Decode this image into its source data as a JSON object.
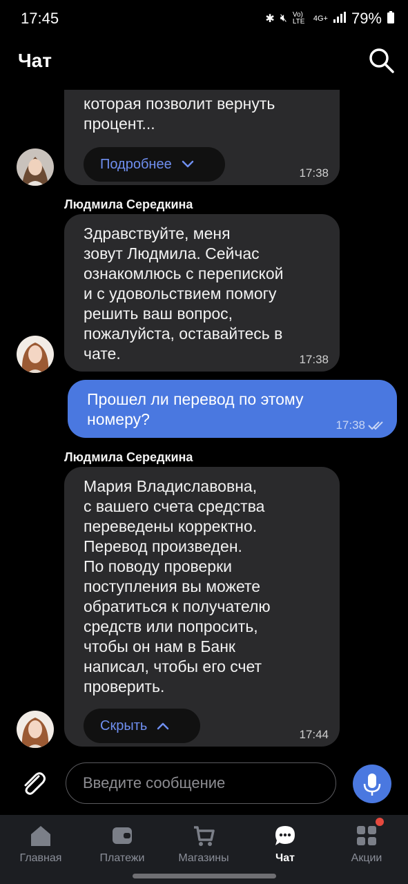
{
  "status": {
    "time": "17:45",
    "network_vo": "Vo) LTE",
    "network_4g": "4G+",
    "battery": "79%"
  },
  "header": {
    "title": "Чат"
  },
  "messages": [
    {
      "type": "incoming",
      "text": "которая позволит вернуть\nпроцент...",
      "button_label": "Подробнее",
      "time": "17:38"
    },
    {
      "type": "incoming",
      "sender": "Людмила Середкина",
      "text": "Здравствуйте, меня\nзовут Людмила. Сейчас\nознакомлюсь с перепиской\nи с удовольствием помогу\nрешить ваш вопрос,\nпожалуйста, оставайтесь в\nчате.",
      "time": "17:38"
    },
    {
      "type": "outgoing",
      "text": "Прошел ли перевод по этому\nномеру?",
      "time": "17:38",
      "status": "read"
    },
    {
      "type": "incoming",
      "sender": "Людмила Середкина",
      "text": "Мария Владиславовна,\nс вашего счета средства\nпереведены корректно.\nПеревод произведен.\nПо поводу проверки\nпоступления вы можете\nобратиться к получателю\nсредств или попросить,\nчтобы он нам в Банк\nнаписал, чтобы его счет\nпроверить.",
      "button_label": "Скрыть",
      "time": "17:44"
    }
  ],
  "composer": {
    "placeholder": "Введите сообщение"
  },
  "tabs": [
    {
      "label": "Главная",
      "icon": "home-icon"
    },
    {
      "label": "Платежи",
      "icon": "wallet-icon"
    },
    {
      "label": "Магазины",
      "icon": "cart-icon"
    },
    {
      "label": "Чат",
      "icon": "chat-icon",
      "active": true
    },
    {
      "label": "Акции",
      "icon": "grid-icon",
      "badge": true
    }
  ],
  "colors": {
    "accent": "#4a78e0",
    "bubble": "#2a2a2c",
    "link": "#6f8ff0",
    "tabbar": "#1c1e22",
    "badge": "#e5493e"
  }
}
